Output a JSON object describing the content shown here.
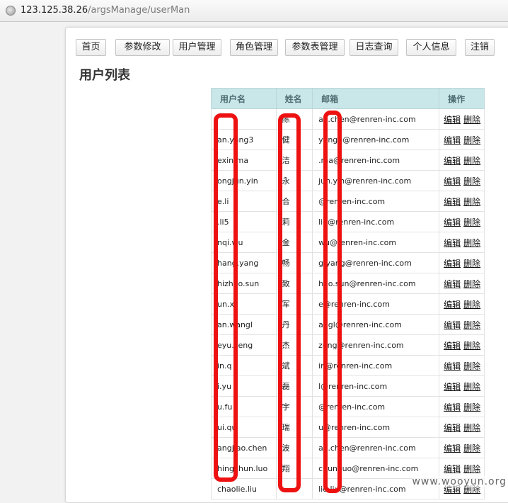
{
  "browser": {
    "url_host": "123.125.38.26",
    "url_path": "/argsManage/userMan",
    "globe_icon": "globe-icon"
  },
  "nav": {
    "items": [
      {
        "label": "首页"
      },
      {
        "label": "参数修改"
      },
      {
        "label": "用户管理"
      },
      {
        "label": "角色管理"
      },
      {
        "label": "参数表管理"
      },
      {
        "label": "日志查询"
      },
      {
        "label": "个人信息"
      },
      {
        "label": "注销"
      }
    ]
  },
  "page": {
    "title": "用户列表"
  },
  "table": {
    "headers": [
      "用户名",
      "姓名",
      "邮箱",
      "操作"
    ],
    "ops": {
      "edit": "编辑",
      "delete": "删除"
    },
    "rows": [
      {
        "username": "",
        "name": "陈",
        "email": "ao.chen@renren-inc.com"
      },
      {
        "username": "an.yang3",
        "name": "健",
        "email": "yang3@renren-inc.com"
      },
      {
        "username": "exin.ma",
        "name": "洁",
        "email": ".ma@renren-inc.com"
      },
      {
        "username": "ongjun.yin",
        "name": "永",
        "email": "jun.yin@renren-inc.com"
      },
      {
        "username": "e.li",
        "name": "合",
        "email": "@renren-inc.com"
      },
      {
        "username": ".li5",
        "name": "莉",
        "email": "li5@renren-inc.com"
      },
      {
        "username": "nqi.wu",
        "name": "金",
        "email": "wu@renren-inc.com"
      },
      {
        "username": "hang.yang",
        "name": "畅",
        "email": "g.yang@renren-inc.com"
      },
      {
        "username": "hizhao.sun",
        "name": "致",
        "email": "hao.sun@renren-inc.com"
      },
      {
        "username": "un.x",
        "name": "军",
        "email": "e@renren-inc.com"
      },
      {
        "username": "an.wangl",
        "name": "丹",
        "email": "angl@renren-inc.com"
      },
      {
        "username": "eyu.zeng",
        "name": "杰",
        "email": "zeng@renren-inc.com"
      },
      {
        "username": "in.q",
        "name": "斌",
        "email": "in@renren-inc.com"
      },
      {
        "username": "i.yu",
        "name": "磊",
        "email": "l@renren-inc.com"
      },
      {
        "username": "u.fu",
        "name": "宇",
        "email": "@renren-inc.com"
      },
      {
        "username": "ui.qu",
        "name": "瑞",
        "email": "u@renren-inc.com"
      },
      {
        "username": "angjiao.chen",
        "name": "波",
        "email": "ao.chen@renren-inc.com"
      },
      {
        "username": "hingchun.luo",
        "name": "翔",
        "email": "chun.luo@renren-inc.com"
      },
      {
        "username": "chaolie.liu",
        "name": "",
        "email": "lie.liu@renren-inc.com"
      }
    ]
  },
  "watermark": "www.wooyun.org",
  "colors": {
    "header_bg": "#c9e6e9",
    "highlight": "#ee1111"
  }
}
